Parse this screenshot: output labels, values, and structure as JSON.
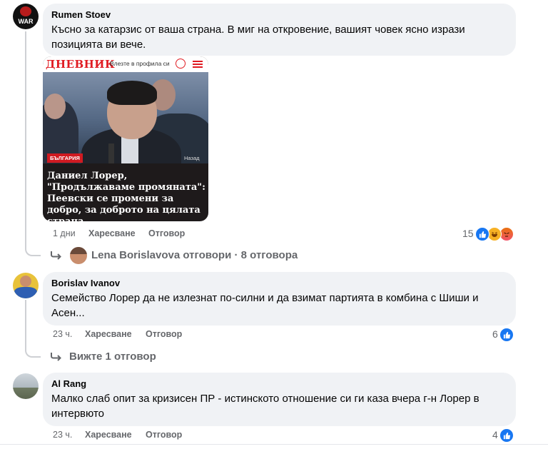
{
  "comments": [
    {
      "author": "Rumen Stoev",
      "text": "Късно за катарзис от ваша страна. В миг на откровение, вашият човек ясно изрази позицията ви вече.",
      "avatar_text": "WAR",
      "time": "1 дни",
      "like_label": "Харесване",
      "reply_label": "Отговор",
      "reactions_count": "15",
      "reaction_icons": [
        "like-icon",
        "haha-icon",
        "angry-icon"
      ],
      "replies_summary": {
        "name": "Lena Borislavova",
        "text": "отговори",
        "separator": "·",
        "count_text": "8 отговора"
      },
      "article": {
        "source": "ДНЕВНИК",
        "login_text": "Влезте в профила си",
        "category": "БЪЛГАРИЯ",
        "back_text": "Назад",
        "headline": "Даниел Лорер, \"Продължаваме промяната\": Пеевски се промени за добро, за доброто на цялата страна"
      }
    },
    {
      "author": "Borislav Ivanov",
      "text": "Семейство Лорер да не излезнат по-силни и да взимат партията в комбина с Шиши и Асен...",
      "time": "23 ч.",
      "like_label": "Харесване",
      "reply_label": "Отговор",
      "reactions_count": "6",
      "reaction_icons": [
        "like-icon"
      ],
      "view_replies": "Вижте 1 отговор"
    },
    {
      "author": "Al Rang",
      "text": "Малко слаб опит за кризисен ПР - истинското отношение си ги каза вчера г-н Лорер в интервюто",
      "time": "23 ч.",
      "like_label": "Харесване",
      "reply_label": "Отговор",
      "reactions_count": "4",
      "reaction_icons": [
        "like-icon"
      ]
    }
  ],
  "colors": {
    "bubble": "#f0f2f5",
    "meta_text": "#65676b",
    "like_blue": "#1877f2",
    "brand_red": "#e01b22"
  }
}
